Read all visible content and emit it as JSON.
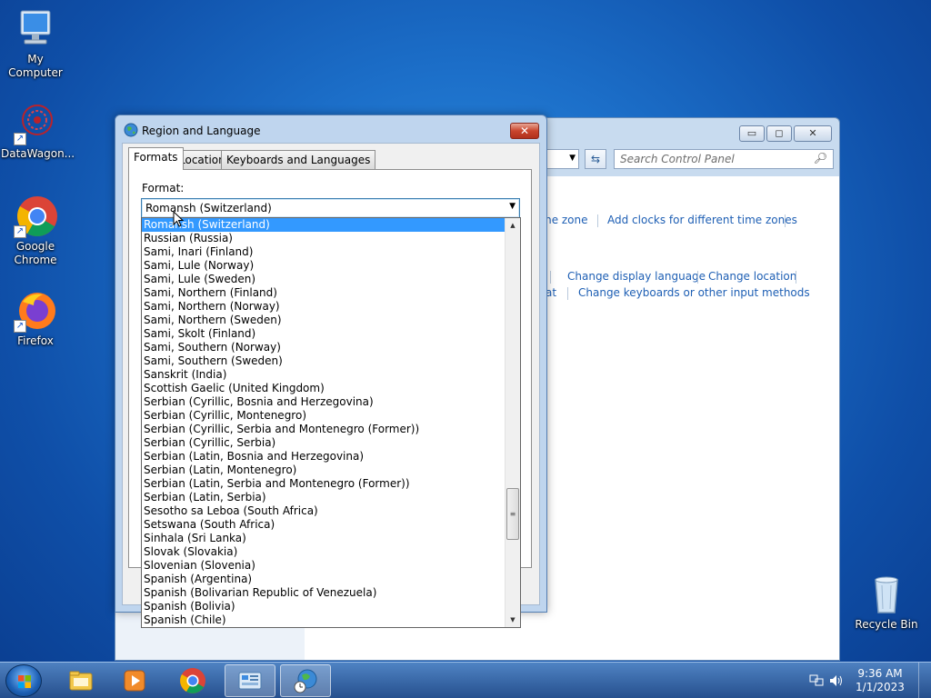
{
  "desktop": {
    "icons": [
      {
        "label": "My Computer"
      },
      {
        "label": "DataWagon..."
      },
      {
        "label": "Google Chrome"
      },
      {
        "label": "Firefox"
      },
      {
        "label": "Recycle Bin"
      }
    ]
  },
  "control_panel": {
    "controls": {
      "minimize": "▭",
      "maximize": "◻",
      "close": "✕"
    },
    "address_dropdown": "▼",
    "refresh": "⇆",
    "search_placeholder": "Search Control Panel",
    "links": {
      "time_zone": "me zone",
      "add_clocks": "Add clocks for different time zones",
      "change_display_language": "Change display language",
      "change_location": "Change location",
      "at": "at",
      "change_keyboards": "Change keyboards or other input methods"
    }
  },
  "dialog": {
    "title": "Region and Language",
    "close": "✕",
    "tabs": [
      "Formats",
      "Location",
      "Keyboards and Languages"
    ],
    "format_label": "Format:",
    "format_value": "Romansh (Switzerland)"
  },
  "dropdown": {
    "selected_index": 0,
    "items": [
      "Romansh (Switzerland)",
      "Russian (Russia)",
      "Sami, Inari (Finland)",
      "Sami, Lule (Norway)",
      "Sami, Lule (Sweden)",
      "Sami, Northern (Finland)",
      "Sami, Northern (Norway)",
      "Sami, Northern (Sweden)",
      "Sami, Skolt (Finland)",
      "Sami, Southern (Norway)",
      "Sami, Southern (Sweden)",
      "Sanskrit (India)",
      "Scottish Gaelic (United Kingdom)",
      "Serbian (Cyrillic, Bosnia and Herzegovina)",
      "Serbian (Cyrillic, Montenegro)",
      "Serbian (Cyrillic, Serbia and Montenegro (Former))",
      "Serbian (Cyrillic, Serbia)",
      "Serbian (Latin, Bosnia and Herzegovina)",
      "Serbian (Latin, Montenegro)",
      "Serbian (Latin, Serbia and Montenegro (Former))",
      "Serbian (Latin, Serbia)",
      "Sesotho sa Leboa (South Africa)",
      "Setswana (South Africa)",
      "Sinhala (Sri Lanka)",
      "Slovak (Slovakia)",
      "Slovenian (Slovenia)",
      "Spanish (Argentina)",
      "Spanish (Bolivarian Republic of Venezuela)",
      "Spanish (Bolivia)",
      "Spanish (Chile)"
    ]
  },
  "taskbar": {
    "items": [
      "start-button",
      "explorer-icon",
      "media-player-icon",
      "chrome-icon",
      "control-panel-icon",
      "region-language-icon"
    ],
    "clock_time": "9:36 AM",
    "clock_date": "1/1/2023"
  },
  "colors": {
    "selection": "#3399ff",
    "link": "#1e5fb4",
    "desktop": "#1c6fc9"
  }
}
